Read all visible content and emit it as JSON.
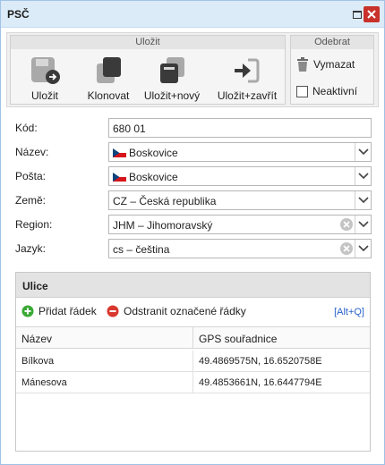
{
  "window": {
    "title": "PSČ"
  },
  "ribbon": {
    "save_group_title": "Uložit",
    "remove_group_title": "Odebrat",
    "buttons": {
      "save": "Uložit",
      "clone": "Klonovat",
      "save_new": "Uložit+nový",
      "save_close": "Uložit+zavřít",
      "delete": "Vymazat",
      "inactive": "Neaktivní"
    }
  },
  "form": {
    "kod": {
      "label": "Kód:",
      "value": "680 01"
    },
    "nazev": {
      "label": "Název:",
      "value": "Boskovice"
    },
    "posta": {
      "label": "Pošta:",
      "value": "Boskovice"
    },
    "zeme": {
      "label": "Země:",
      "value": "CZ – Česká republika"
    },
    "region": {
      "label": "Region:",
      "value": "JHM – Jihomoravský"
    },
    "jazyk": {
      "label": "Jazyk:",
      "value": "cs – čeština"
    }
  },
  "streets": {
    "title": "Ulice",
    "add_label": "Přidat řádek",
    "remove_label": "Odstranit označené řádky",
    "shortcut": "[Alt+Q]",
    "columns": [
      "Název",
      "GPS souřadnice"
    ],
    "rows": [
      {
        "name": "Bílkova",
        "gps": "49.4869575N, 16.6520758E"
      },
      {
        "name": "Mánesova",
        "gps": "49.4853661N, 16.6447794E"
      }
    ]
  },
  "colors": {
    "accent": "#dcebf8",
    "close": "#c9312b",
    "add": "#3aa935",
    "remove": "#d9382e",
    "link": "#2a62c9"
  },
  "icons": [
    "save-icon",
    "clone-icon",
    "save-new-icon",
    "save-close-icon",
    "trash-icon",
    "checkbox",
    "cz-flag-icon",
    "chevron-down-icon",
    "clear-icon",
    "plus-circle-icon",
    "minus-circle-icon",
    "close-icon",
    "maximize-icon"
  ]
}
